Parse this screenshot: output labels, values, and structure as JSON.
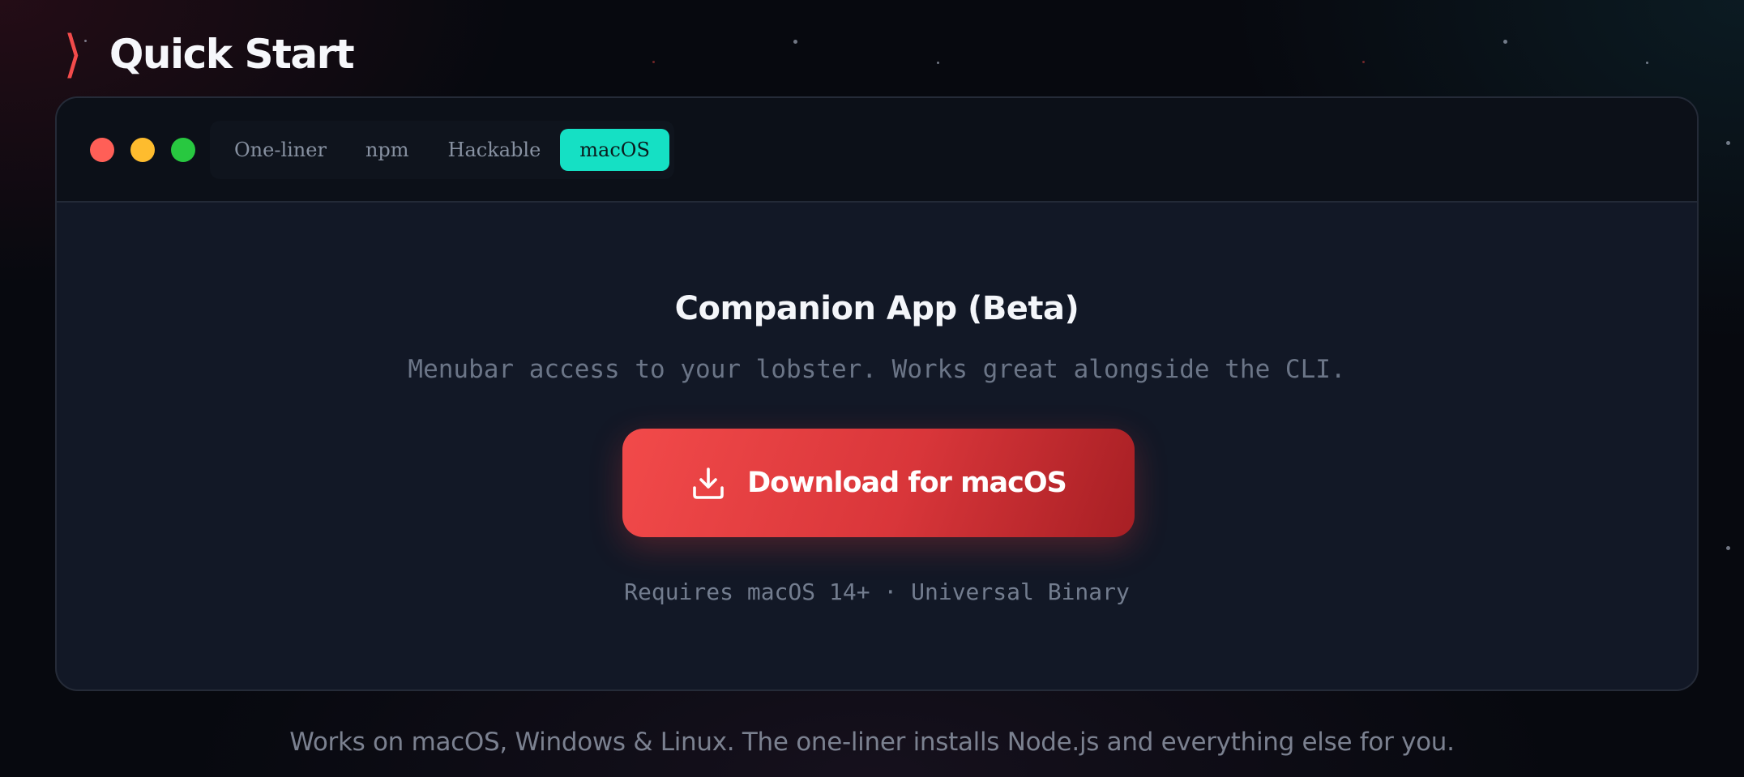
{
  "section": {
    "chevron": "❭",
    "title": "Quick Start"
  },
  "terminal": {
    "tabs": [
      {
        "label": "One-liner",
        "active": false
      },
      {
        "label": "npm",
        "active": false
      },
      {
        "label": "Hackable",
        "active": false
      },
      {
        "label": "macOS",
        "active": true
      }
    ],
    "active_tab_color": "#15e0c4"
  },
  "panel": {
    "title": "Companion App (Beta)",
    "subtitle": "Menubar access to your lobster. Works great alongside the CLI.",
    "download_button": {
      "label": "Download for macOS",
      "icon": "download-icon",
      "color": "#f24a4a"
    },
    "requirements": "Requires macOS 14+ · Universal Binary"
  },
  "footer": {
    "note": "Works on macOS, Windows & Linux. The one-liner installs Node.js and everything else for you."
  },
  "colors": {
    "accent_red": "#f24b4b",
    "accent_teal": "#15e0c4",
    "background": "#07090f"
  }
}
